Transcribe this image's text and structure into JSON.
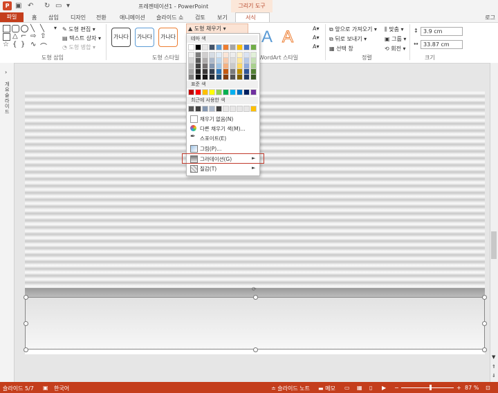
{
  "window": {
    "app_icon": "P",
    "title": "프레젠테이션1 - PowerPoint",
    "context_tools": "그리기 도구",
    "login": "로그"
  },
  "tabs": [
    "홈",
    "삽입",
    "디자인",
    "전환",
    "애니메이션",
    "슬라이드 쇼",
    "검토",
    "보기",
    "서식"
  ],
  "file_tab": "파일",
  "ribbon": {
    "shape_insert": {
      "label": "도형 삽입",
      "edit_shape": "도형 편집",
      "text_box": "텍스트 상자",
      "merge_shapes": "도형 병합"
    },
    "shape_styles": {
      "label": "도형 스타일",
      "style_text": "가나다",
      "fill_button": "도형 채우기"
    },
    "wordart": {
      "label": "WordArt 스타일",
      "letter": "A"
    },
    "arrange": {
      "label": "정렬",
      "bring_forward": "앞으로 가져오기",
      "send_backward": "뒤로 보내기",
      "selection_pane": "선택 창",
      "align": "맞춤",
      "group": "그룹",
      "rotate": "회전"
    },
    "size": {
      "label": "크기",
      "height": "3.9 cm",
      "width": "33.87 cm"
    }
  },
  "left_panel": {
    "outline_label": "개요슬라이드"
  },
  "fill_menu": {
    "theme_colors_header": "테마 색",
    "standard_colors_header": "표준 색",
    "recent_colors_header": "최근에 사용한 색",
    "theme_top_row": [
      "#ffffff",
      "#000000",
      "#e7e6e6",
      "#44546a",
      "#5b9bd5",
      "#ed7d31",
      "#a5a5a5",
      "#ffc000",
      "#4472c4",
      "#70ad47"
    ],
    "theme_shade_rows": [
      [
        "#f2f2f2",
        "#7f7f7f",
        "#d0cece",
        "#d6dce4",
        "#deebf7",
        "#fbe5d6",
        "#ededed",
        "#fff2cc",
        "#dae3f3",
        "#e2f0d9"
      ],
      [
        "#d9d9d9",
        "#595959",
        "#aeabab",
        "#adb9ca",
        "#bdd7ee",
        "#f8cbad",
        "#dbdbdb",
        "#ffe699",
        "#b4c7e7",
        "#c5e0b4"
      ],
      [
        "#bfbfbf",
        "#404040",
        "#757171",
        "#8497b0",
        "#9dc3e6",
        "#f4b183",
        "#c9c9c9",
        "#ffd966",
        "#8faadc",
        "#a9d18e"
      ],
      [
        "#a6a6a6",
        "#262626",
        "#3b3838",
        "#333f50",
        "#2e75b6",
        "#c55a11",
        "#7b7b7b",
        "#bf9000",
        "#2f5597",
        "#548235"
      ],
      [
        "#808080",
        "#0d0d0d",
        "#171515",
        "#222a35",
        "#1f4e79",
        "#843c0c",
        "#525252",
        "#7f6000",
        "#203864",
        "#385723"
      ]
    ],
    "standard_colors": [
      "#c00000",
      "#ff0000",
      "#ffc000",
      "#ffff00",
      "#92d050",
      "#00b050",
      "#00b0f0",
      "#0070c0",
      "#002060",
      "#7030a0"
    ],
    "recent_colors": [
      "#595959",
      "#404040",
      "#8497b0",
      "#adb9ca",
      "#404040",
      "#e7e6e6",
      "#e7e6e6",
      "#e7e6e6",
      "#e7e6e6",
      "#ffc000"
    ],
    "items": [
      {
        "label": "채우기 없음(N)",
        "icon": "no-fill-icon"
      },
      {
        "label": "다른 채우기 색(M)...",
        "icon": "color-wheel-icon"
      },
      {
        "label": "스포이트(E)",
        "icon": "eyedropper-icon"
      },
      {
        "label": "그림(P)...",
        "icon": "picture-icon"
      },
      {
        "label": "그라데이션(G)",
        "icon": "gradient-icon",
        "submenu": true,
        "highlighted": true
      },
      {
        "label": "질감(T)",
        "icon": "texture-icon",
        "submenu": true
      }
    ]
  },
  "status": {
    "slide": "슬라이드 5/7",
    "language": "한국어",
    "notes": "슬라이드 노트",
    "comments": "메모",
    "zoom": "87 %",
    "zoom_level": 0.87
  },
  "colors": {
    "accent": "#c43e1c",
    "highlight_box": "#c0392b"
  }
}
